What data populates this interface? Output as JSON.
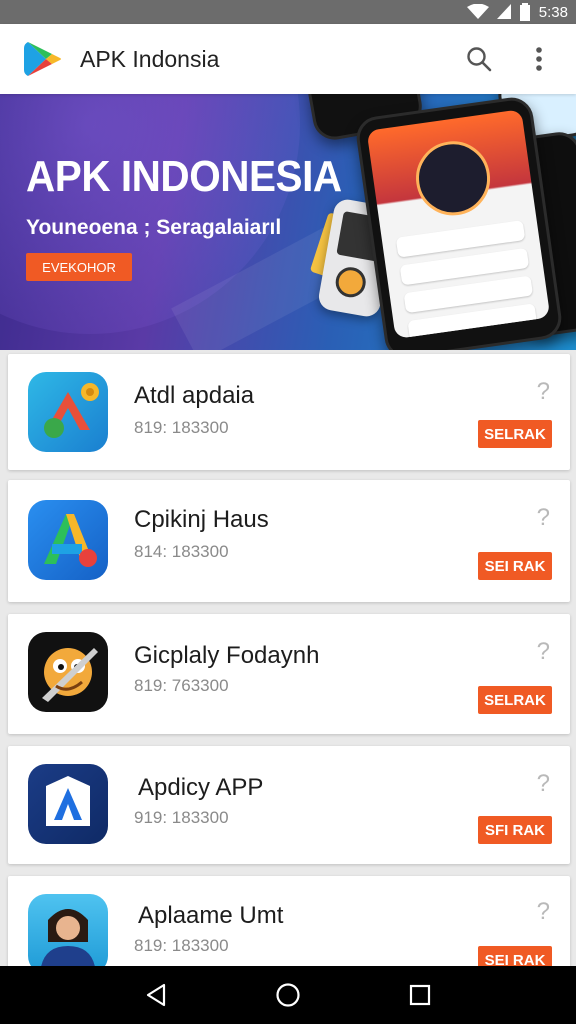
{
  "status_bar": {
    "time": "5:38"
  },
  "app_bar": {
    "title": "APK Indonsia"
  },
  "banner": {
    "title": "APK INDONESIA",
    "subtitle": "Youneoena ; Seragalaiarıl",
    "button_label": "EVEKOHOR"
  },
  "apps": [
    {
      "name": "Atdl apdaia",
      "meta": "819: 183300",
      "help": "?",
      "button": "SELRAK",
      "icon": "ads-app-icon"
    },
    {
      "name": "Cpikinj Haus",
      "meta": "814: 183300",
      "help": "?",
      "button": "SEI RAK",
      "icon": "letter-a-app-icon"
    },
    {
      "name": "Gicplaly Fodaynh",
      "meta": "819: 763300",
      "help": "?",
      "button": "SELRAK",
      "icon": "game-character-app-icon"
    },
    {
      "name": "Apdicy APP",
      "meta": "919: 183300",
      "help": "?",
      "button": "SFI RAK",
      "icon": "shield-a-app-icon"
    },
    {
      "name": "Aplaame Umt",
      "meta": "819: 183300",
      "help": "?",
      "button": "SEI RAK",
      "icon": "person-app-icon"
    }
  ],
  "colors": {
    "accent": "#f05a24",
    "status_bar": "#6c6c6c",
    "nav_bar": "#000000"
  }
}
